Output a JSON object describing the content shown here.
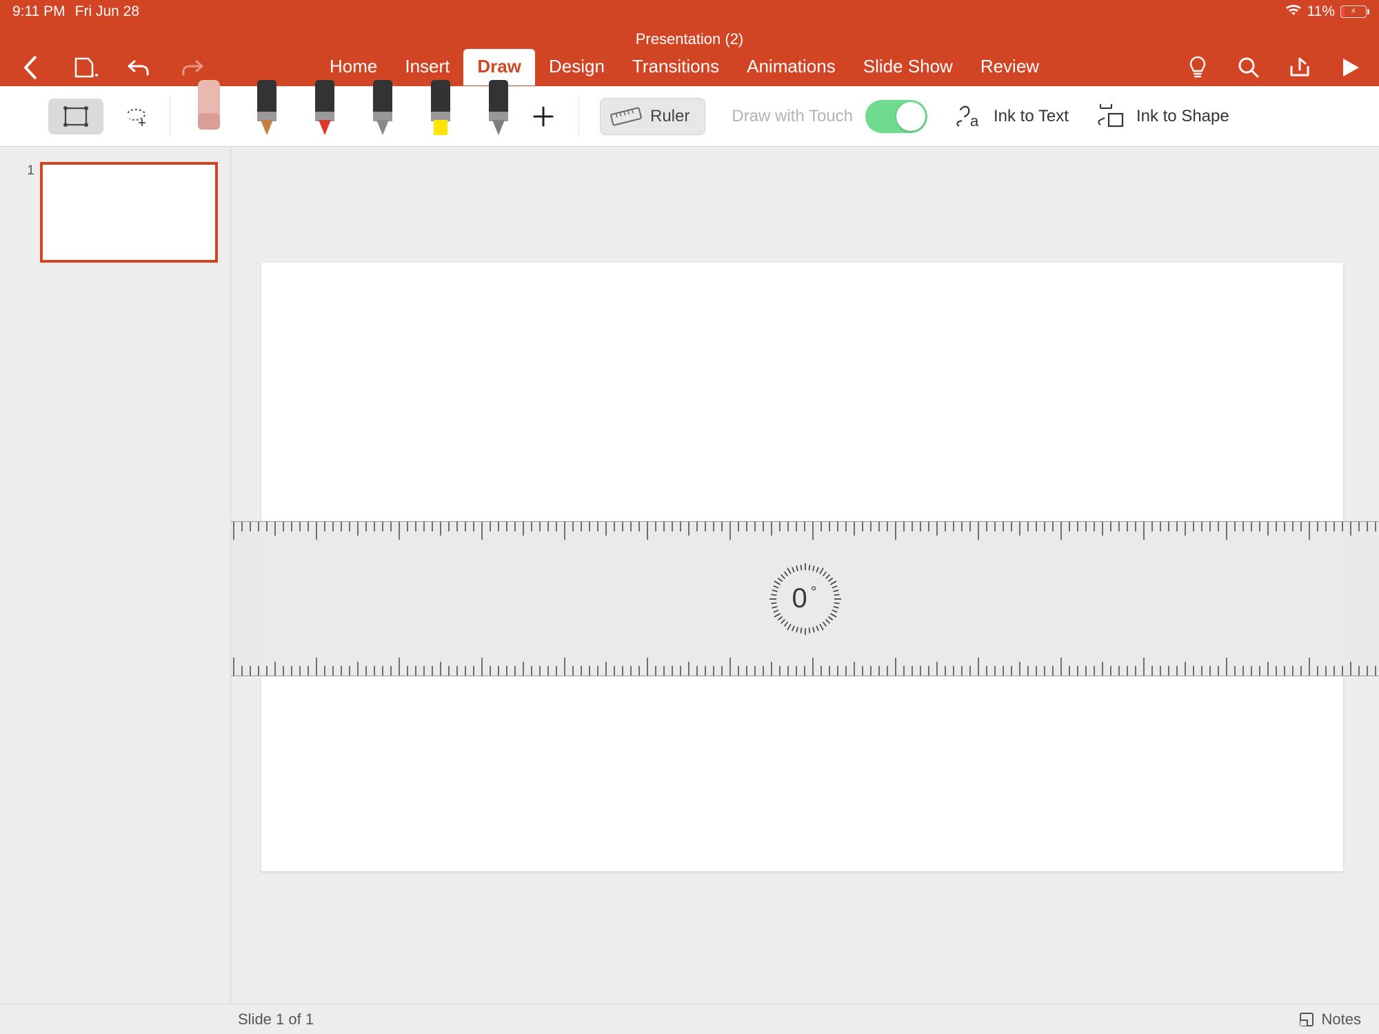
{
  "status": {
    "time": "9:11 PM",
    "date": "Fri Jun 28",
    "battery": "11%"
  },
  "doc_title": "Presentation (2)",
  "ribbon": {
    "tabs": [
      "Home",
      "Insert",
      "Draw",
      "Design",
      "Transitions",
      "Animations",
      "Slide Show",
      "Review"
    ],
    "active": "Draw"
  },
  "drawbar": {
    "ruler_label": "Ruler",
    "draw_with_touch": "Draw with Touch",
    "ink_to_text": "Ink to Text",
    "ink_to_shape": "Ink to Shape",
    "pens": [
      {
        "name": "eraser-tool",
        "body": "#e8b9b1",
        "tip": "#d99e95"
      },
      {
        "name": "pen-darkorange",
        "body": "#333",
        "tip": "#c08040"
      },
      {
        "name": "pen-red",
        "body": "#333",
        "tip": "#d63a2a"
      },
      {
        "name": "pencil-gray",
        "body": "#333",
        "tip": "#8a8a8a"
      },
      {
        "name": "highlighter-yellow",
        "body": "#333",
        "tip": "#ffe400"
      },
      {
        "name": "pen-gray",
        "body": "#333",
        "tip": "#7d7d7d"
      }
    ]
  },
  "thumbnail": {
    "number": "1"
  },
  "ruler": {
    "angle": "0",
    "deg": "°"
  },
  "footer": {
    "slide_info": "Slide 1 of 1",
    "notes": "Notes"
  }
}
